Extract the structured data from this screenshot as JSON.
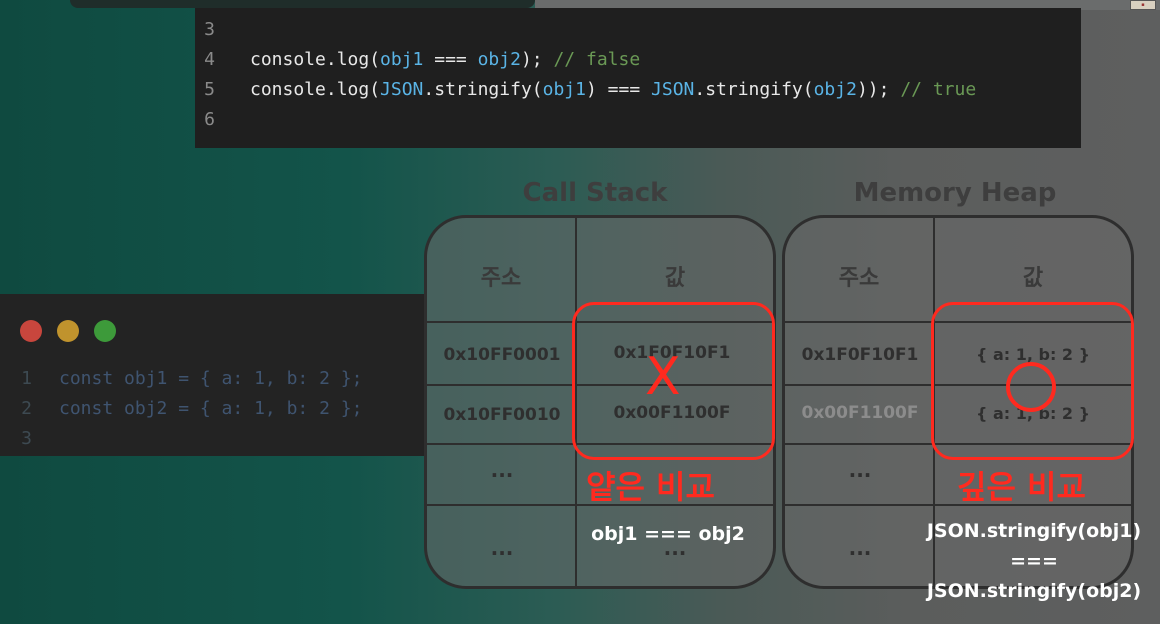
{
  "top_code": {
    "lines": [
      {
        "num": "3",
        "parts": []
      },
      {
        "num": "4",
        "parts": [
          {
            "t": "console.log(",
            "c": "fn"
          },
          {
            "t": "obj1",
            "c": "var"
          },
          {
            "t": " === ",
            "c": "pun"
          },
          {
            "t": "obj2",
            "c": "var"
          },
          {
            "t": "); ",
            "c": "pun"
          },
          {
            "t": "// false",
            "c": "com"
          }
        ]
      },
      {
        "num": "5",
        "parts": [
          {
            "t": "console.log(",
            "c": "fn"
          },
          {
            "t": "JSON",
            "c": "var"
          },
          {
            "t": ".stringify(",
            "c": "fn"
          },
          {
            "t": "obj1",
            "c": "var"
          },
          {
            "t": ") === ",
            "c": "pun"
          },
          {
            "t": "JSON",
            "c": "var"
          },
          {
            "t": ".stringify(",
            "c": "fn"
          },
          {
            "t": "obj2",
            "c": "var"
          },
          {
            "t": ")); ",
            "c": "pun"
          },
          {
            "t": "// true",
            "c": "com"
          }
        ]
      },
      {
        "num": "6",
        "parts": []
      }
    ]
  },
  "left_code": {
    "window_dots": {
      "red": "#c8463d",
      "yellow": "#c0932d",
      "green": "#3d9a3a"
    },
    "lines": [
      {
        "num": "1",
        "text": "const obj1 = { a: 1, b: 2 };"
      },
      {
        "num": "2",
        "text": "const obj2 = { a: 1, b: 2 };"
      },
      {
        "num": "3",
        "text": ""
      }
    ]
  },
  "diagram": {
    "call_stack": {
      "title": "Call Stack",
      "header_address": "주소",
      "header_value": "값",
      "rows": [
        {
          "address": "0x10FF0001",
          "value": "0x1F0F10F1"
        },
        {
          "address": "0x10FF0010",
          "value": "0x00F1100F"
        },
        {
          "address": "...",
          "value": ""
        },
        {
          "address": "...",
          "value": "..."
        }
      ],
      "mark": "X",
      "label": "얕은 비교",
      "caption": "obj1 === obj2"
    },
    "memory_heap": {
      "title": "Memory Heap",
      "header_address": "주소",
      "header_value": "값",
      "rows": [
        {
          "address": "0x1F0F10F1",
          "value": "{ a: 1, b: 2 }"
        },
        {
          "address": "0x00F1100F",
          "value": "{ a: 1, b: 2 }"
        },
        {
          "address": "...",
          "value": ""
        },
        {
          "address": "...",
          "value": ""
        }
      ],
      "mark": "O",
      "label": "깊은 비교",
      "caption_line1": "JSON.stringify(obj1)",
      "caption_line2": "===",
      "caption_line3": "JSON.stringify(obj2)"
    },
    "accent_color": "#ff2a1f"
  }
}
